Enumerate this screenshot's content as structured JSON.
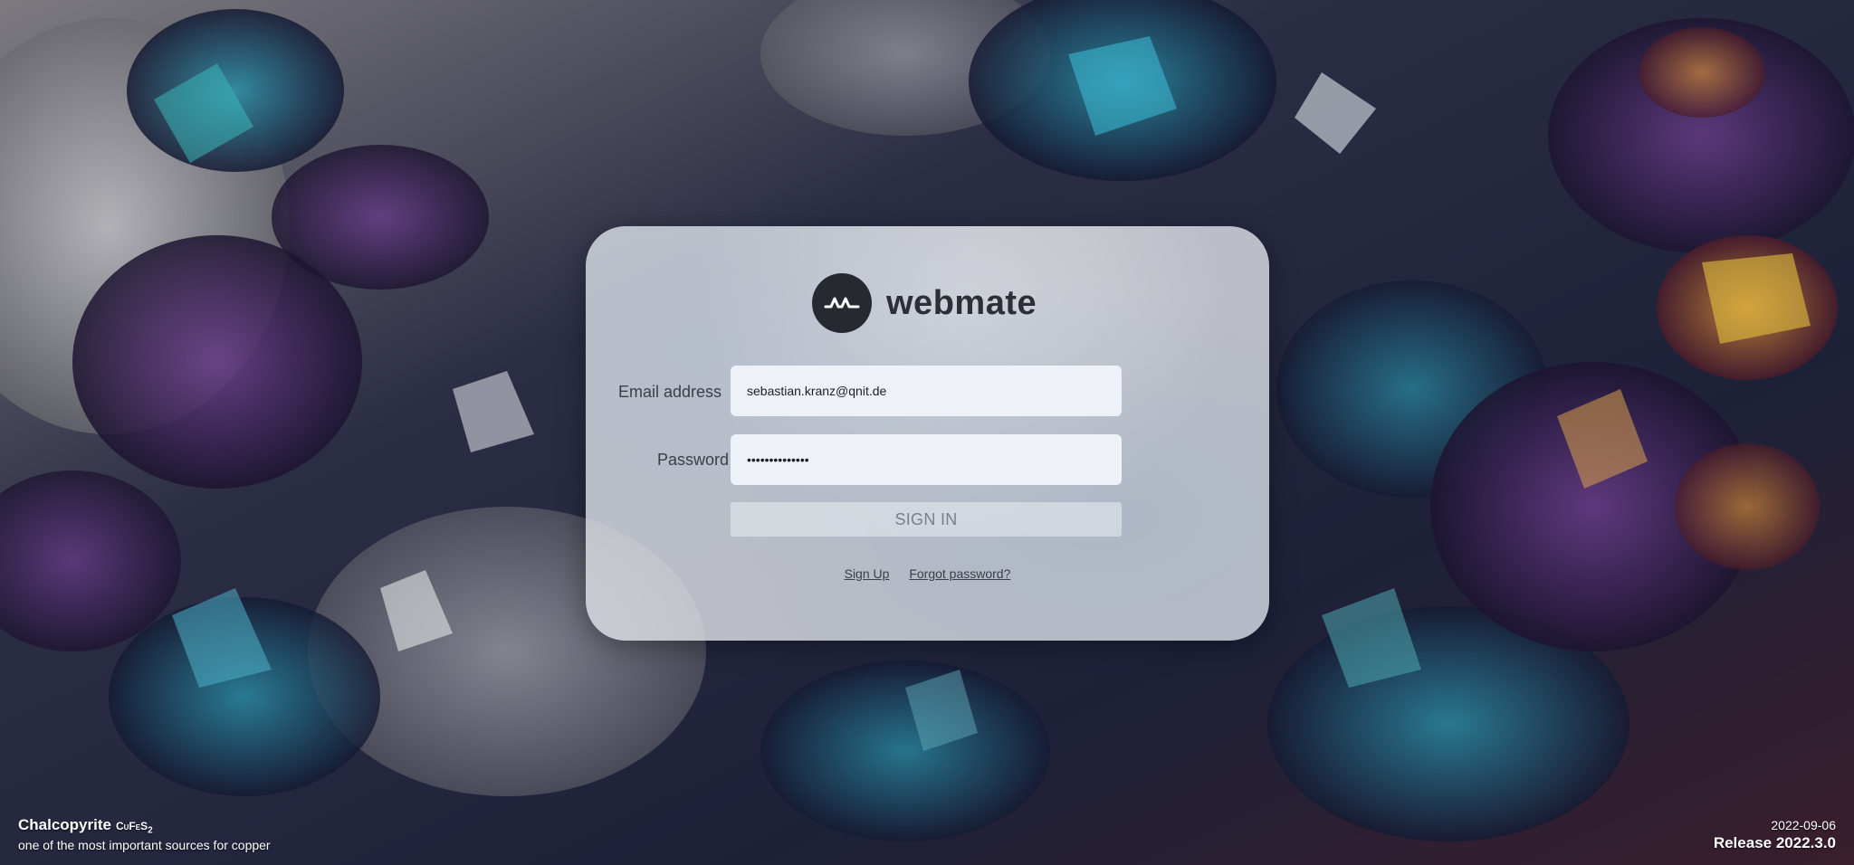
{
  "brand": {
    "name": "webmate",
    "logo_icon": "webmate-wave-icon",
    "color": "#262a30"
  },
  "login": {
    "email_label": "Email address",
    "email_value": "sebastian.kranz@qnit.de",
    "password_label": "Password",
    "password_value": "••••••••••••••",
    "signin_label": "SIGN IN",
    "signup_link": "Sign Up",
    "forgot_link": "Forgot password?"
  },
  "footer": {
    "mineral_name": "Chalcopyrite",
    "mineral_formula": "CuFeS",
    "mineral_formula_sub": "2",
    "mineral_desc": "one of the most important sources for copper",
    "release_date": "2022-09-06",
    "release_version": "Release 2022.3.0"
  },
  "colors": {
    "card_bg": "#e1e4e8",
    "input_bg": "#eef2f8",
    "text": "#3a3f47"
  }
}
